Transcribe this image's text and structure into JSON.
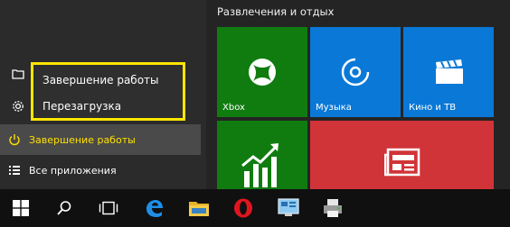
{
  "start_menu": {
    "group_title": "Развлечения и отдых",
    "items": {
      "power": {
        "label": "Завершение работы",
        "icon": "power-icon"
      },
      "all_apps": {
        "label": "Все приложения",
        "icon": "list-icon"
      }
    },
    "power_popup": {
      "options": [
        "Завершение работы",
        "Перезагрузка"
      ]
    }
  },
  "tiles": {
    "xbox": {
      "label": "Xbox",
      "color": "#107c10",
      "icon": "xbox-icon"
    },
    "music": {
      "label": "Музыка",
      "color": "#0a78d7",
      "icon": "music-disc-icon"
    },
    "movies": {
      "label": "Кино и ТВ",
      "color": "#0a78d7",
      "icon": "clapperboard-icon"
    },
    "money": {
      "label": "",
      "color": "#107c10",
      "icon": "chart-up-icon"
    },
    "news": {
      "label": "",
      "color": "#d13438",
      "icon": "newspaper-icon"
    }
  },
  "colors": {
    "highlight": "#ffe600",
    "taskbar": "#101010"
  },
  "taskbar": {
    "icons": [
      "windows-start-icon",
      "search-icon",
      "task-view-icon",
      "edge-icon",
      "file-explorer-icon",
      "opera-icon",
      "control-panel-icon",
      "printer-icon"
    ]
  }
}
